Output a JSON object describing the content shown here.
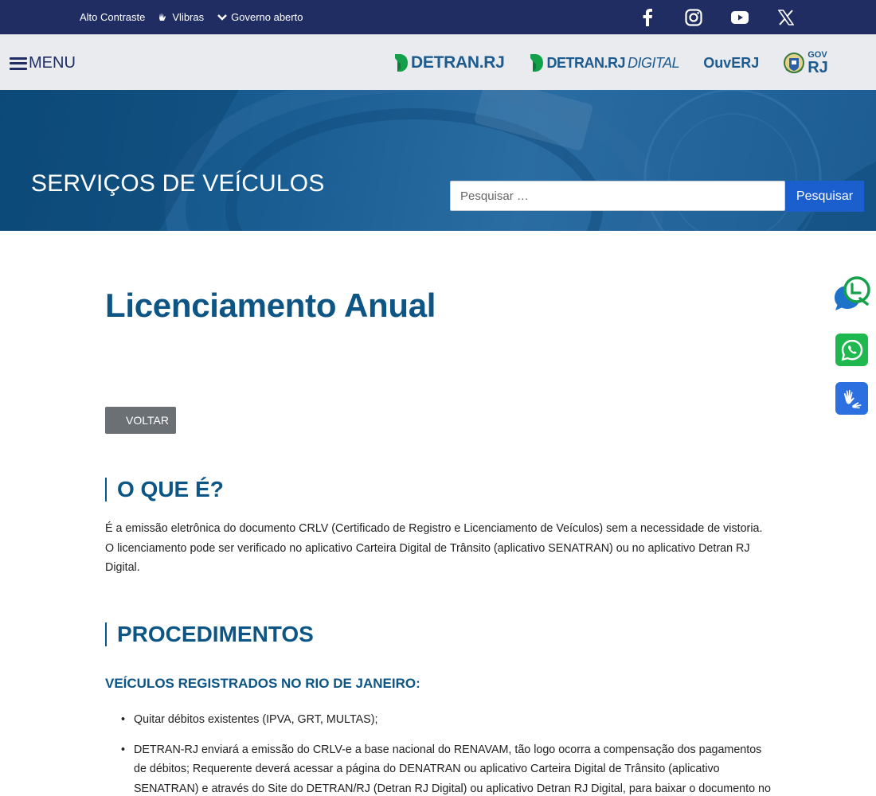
{
  "topbar": {
    "links": [
      {
        "label": "Alto Contraste",
        "icon": "none"
      },
      {
        "label": "Vlibras",
        "icon": "hands-icon"
      },
      {
        "label": "Governo aberto",
        "icon": "chevron-down-icon"
      }
    ],
    "social": [
      "facebook-icon",
      "instagram-icon",
      "youtube-icon",
      "x-icon"
    ]
  },
  "header": {
    "menu_label": "MENU",
    "logos": {
      "detran": "DETRAN.RJ",
      "detran_digital_main": "DETRAN.RJ",
      "detran_digital_suffix": "DIGITAL",
      "ouvidoria": "OuvERJ",
      "gov_small": "GOV",
      "gov_big": "RJ"
    }
  },
  "hero": {
    "title": "SERVIÇOS DE VEÍCULOS",
    "search_placeholder": "Pesquisar …",
    "search_button": "Pesquisar"
  },
  "main": {
    "title": "Licenciamento Anual",
    "back_button": "VOLTAR",
    "section1": {
      "heading": "O QUE É?",
      "text": "É a emissão eletrônica do documento CRLV (Certificado de Registro e Licenciamento de Veículos) sem a necessidade de vistoria. O licenciamento pode ser verificado no aplicativo Carteira Digital de Trânsito (aplicativo SENATRAN) ou no aplicativo Detran RJ Digital."
    },
    "section2": {
      "heading": "PROCEDIMENTOS",
      "subheading": "VEÍCULOS REGISTRADOS NO RIO DE JANEIRO:",
      "items": [
        "Quitar débitos existentes (IPVA, GRT, MULTAS);",
        "DETRAN-RJ enviará a emissão do CRLV-e a base nacional do RENAVAM, tão logo ocorra a compensação dos pagamentos de débitos; Requerente deverá acessar a página do DENATRAN ou aplicativo Carteira Digital de Trânsito (aplicativo SENATRAN) e através do Site do DETRAN/RJ (Detran RJ Digital) ou aplicativo Detran RJ Digital, para baixar o documento no formato PDF,"
      ]
    }
  },
  "floating": [
    "chat-icon",
    "whatsapp-icon",
    "libras-icon"
  ],
  "colors": {
    "topbar": "#1f2d63",
    "header": "#e9ebee",
    "hero": "#1a5e93",
    "primary_text": "#0c5585",
    "search_button": "#1b5fcf",
    "back_button": "#6b7075",
    "whatsapp": "#1fb84f",
    "libras": "#2b6fe0",
    "logo_green": "#14a04a"
  }
}
